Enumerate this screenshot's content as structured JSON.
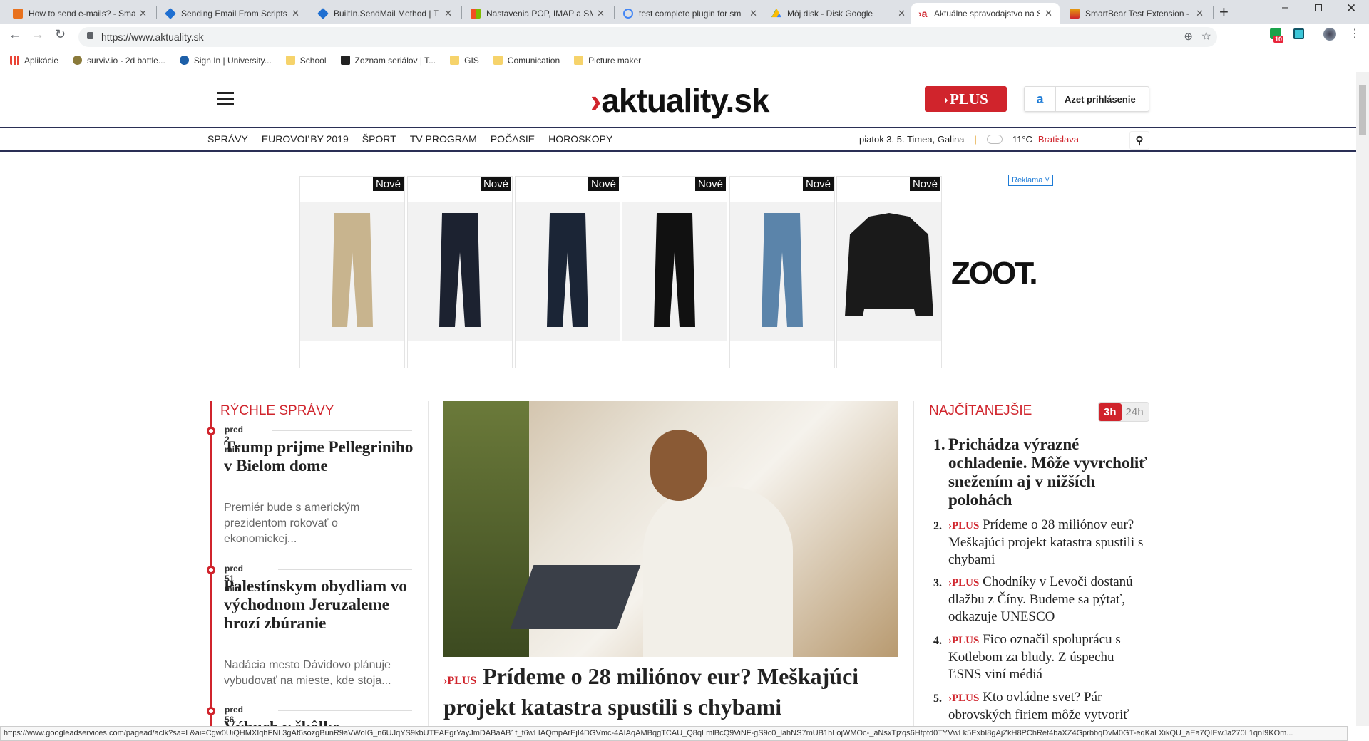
{
  "browser": {
    "tabs": [
      {
        "title": "How to send e-mails? - Sma",
        "color": "#e8711d"
      },
      {
        "title": "Sending Email From Scripts",
        "color": "#1f6fd1"
      },
      {
        "title": "BuiltIn.SendMail Method | T",
        "color": "#1f6fd1"
      },
      {
        "title": "Nastavenia POP, IMAP a SM",
        "color": "#f25022"
      },
      {
        "title": "test complete plugin for sm",
        "color": "#4285f4"
      },
      {
        "title": "Môj disk - Disk Google",
        "color": "#0f9d58"
      },
      {
        "title": "Aktuálne spravodajstvo na S",
        "color": "#d0242c"
      },
      {
        "title": "SmartBear Test Extension - I",
        "color": "#e5a00d"
      }
    ],
    "url": "https://www.aktuality.sk",
    "extension_badge": "10",
    "bookmarks": [
      {
        "label": "Aplikácie",
        "color": "#ea4335"
      },
      {
        "label": "surviv.io - 2d battle...",
        "color": "#8a7a3a"
      },
      {
        "label": "Sign In | University...",
        "color": "#1d5fa8"
      },
      {
        "label": "School",
        "color": "#f6d36b"
      },
      {
        "label": "Zoznam seriálov | T...",
        "color": "#222"
      },
      {
        "label": "GIS",
        "color": "#f6d36b"
      },
      {
        "label": "Comunication",
        "color": "#f6d36b"
      },
      {
        "label": "Picture maker",
        "color": "#f6d36b"
      }
    ],
    "status_url": "https://www.googleadservices.com/pagead/aclk?sa=L&ai=Cgw0UiQHMXIqhFNL3gAf6sozgBunR9aVWoIG_n6UJqYS9kbUTEAEgrYayJmDABaAB1t_t6wLIAQmpArEjI4DGVmc-4AIAqAMBqgTCAU_Q8qLmlBcQ9ViNF-gS9c0_lahNS7mUB1hLojWMOc-_aNsxTjzqs6Htpfd0TYVwLk5ExbI8gAjZkH8PChRet4baXZ4GprbbqDvM0GT-eqKaLXikQU_aEa7QIEwJa270L1qnI9KOm..."
  },
  "header": {
    "logo": "aktuality.sk",
    "plus_label": "PLUS",
    "login_label": "Azet prihlásenie",
    "nav": [
      "SPRÁVY",
      "EUROVOĽBY 2019",
      "ŠPORT",
      "TV PROGRAM",
      "POČASIE",
      "HOROSKOPY"
    ],
    "date_names": "piatok 3. 5. Timea, Galina",
    "temperature": "11°C",
    "city": "Bratislava"
  },
  "ad": {
    "badge": "Nové",
    "brand": "ZOOT.",
    "reklama": "Reklama",
    "products": [
      {
        "color": "#c8b48e"
      },
      {
        "color": "#1c2230"
      },
      {
        "color": "#1b2536"
      },
      {
        "color": "#111"
      },
      {
        "color": "#5b84aa"
      },
      {
        "color": "#1a1a1a"
      }
    ]
  },
  "quick_news": {
    "title": "RÝCHLE SPRÁVY",
    "items": [
      {
        "time": "pred 2 min",
        "headline": "Trump prijme Pellegriniho v Bielom dome",
        "perex": "Premiér bude s americkým prezidentom rokovať o ekonomickej..."
      },
      {
        "time": "pred 51 min",
        "headline": "Palestínskym obydliam vo východnom Jeruzaleme hrozí zbúranie",
        "perex": "Nadácia mesto Dávidovo plánuje vybudovať na mieste, kde stoja..."
      },
      {
        "time": "pred 56 min",
        "headline": "Výbuch v škôlke"
      }
    ]
  },
  "main_article": {
    "plus": "PLUS",
    "headline": "Prídeme o 28 miliónov eur? Meškajúci projekt katastra spustili s chybami"
  },
  "most_read": {
    "title": "NAJČÍTANEJŠIE",
    "tabs": [
      "3h",
      "24h"
    ],
    "items": [
      {
        "num": "1.",
        "text": "Prichádza výrazné ochladenie. Môže vyvrcholiť snežením aj v nižších polohách",
        "plus": ""
      },
      {
        "num": "2.",
        "plus": "PLUS",
        "text": "Prídeme o 28 miliónov eur? Meškajúci projekt katastra spustili s chybami"
      },
      {
        "num": "3.",
        "plus": "PLUS",
        "text": "Chodníky v Levoči dostanú dlažbu z Číny. Budeme sa pýtať, odkazuje UNESCO"
      },
      {
        "num": "4.",
        "plus": "PLUS",
        "text": "Fico označil spoluprácu s Kotlebom za bludy. Z úspechu ĽSNS viní médiá"
      },
      {
        "num": "5.",
        "plus": "PLUS",
        "text": "Kto ovládne svet? Pár obrovských firiem môže vytvoriť"
      }
    ]
  }
}
